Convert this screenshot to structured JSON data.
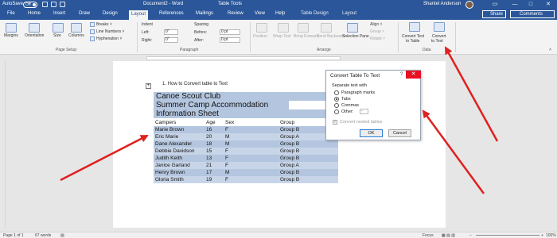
{
  "titlebar": {
    "autosave_label": "AutoSave",
    "autosave_state": "Off",
    "document_title": "Document2 - Word",
    "context_title": "Table Tools",
    "user_name": "Shantel Anderson",
    "minimize": "—",
    "maximize": "□",
    "close": "✕"
  },
  "menu": {
    "tabs": [
      "File",
      "Home",
      "Insert",
      "Draw",
      "Design",
      "Layout",
      "References",
      "Mailings",
      "Review",
      "View",
      "Help",
      "Table Design",
      "Layout"
    ],
    "active_tab": "Layout",
    "share_label": "Share",
    "comments_label": "Comments"
  },
  "ribbon": {
    "page_setup": {
      "buttons": [
        "Margins",
        "Orientation",
        "Size",
        "Columns"
      ],
      "breaks": "Breaks ˅",
      "line_numbers": "Line Numbers ˅",
      "hyphenation": "Hyphenation ˅",
      "group_label": "Page Setup"
    },
    "paragraph": {
      "indent_label": "Indent",
      "left_label": "Left:",
      "left_value": "0\"",
      "right_label": "Right:",
      "right_value": "0\"",
      "spacing_label": "Spacing",
      "before_label": "Before:",
      "before_value": "0 pt",
      "after_label": "After:",
      "after_value": "0 pt",
      "group_label": "Paragraph"
    },
    "arrange": {
      "position": "Position",
      "wrap_text": "Wrap Text",
      "bring_forward": "Bring Forward",
      "send_backward": "Send Backward",
      "selection_pane": "Selection Pane",
      "align": "Align ˅",
      "group": "Group ˅",
      "rotate": "Rotate ˅",
      "group_label": "Arrange"
    },
    "data": {
      "convert_text_to_table_1": "Convert Text",
      "convert_text_to_table_2": "to Table",
      "convert_to_text_1": "Convert",
      "convert_to_text_2": "to Text",
      "group_label": "Data"
    }
  },
  "document": {
    "list_item": "1.    How to Convert table to Text",
    "table": {
      "title_rows": [
        "Canoe Scout Club",
        "Summer Camp Accommodation",
        "Information Sheet"
      ],
      "headers": [
        "Campers",
        "Age",
        "Sex",
        "Group"
      ],
      "rows": [
        [
          "Marie Brown",
          "16",
          "F",
          "Group B"
        ],
        [
          "Eric Marie",
          "20",
          "M",
          "Group A"
        ],
        [
          "Dane Alexander",
          "18",
          "M",
          "Group B"
        ],
        [
          "Debbie Davidson",
          "15",
          "F",
          "Group B"
        ],
        [
          "Judith Keith",
          "13",
          "F",
          "Group B"
        ],
        [
          "Janice Garland",
          "21",
          "F",
          "Group A"
        ],
        [
          "Henry Brown",
          "17",
          "M",
          "Group B"
        ],
        [
          "Gloria Smith",
          "19",
          "F",
          "Group B"
        ]
      ]
    }
  },
  "dialog": {
    "title": "Convert Table To Text",
    "help": "?",
    "close": "✕",
    "separate_label": "Separate text with",
    "options": [
      "Paragraph marks",
      "Tabs",
      "Commas",
      "Other:"
    ],
    "selected_option": "Tabs",
    "other_value": "-",
    "nested_label": "Convert nested tables",
    "ok_label": "OK",
    "cancel_label": "Cancel"
  },
  "statusbar": {
    "page": "Page 1 of 1",
    "words": "67 words",
    "focus": "Focus",
    "zoom": "100%"
  },
  "colors": {
    "word_blue": "#2b579a",
    "table_highlight": "#b4c6df",
    "arrow_red": "#e02020",
    "close_red": "#e81123"
  }
}
